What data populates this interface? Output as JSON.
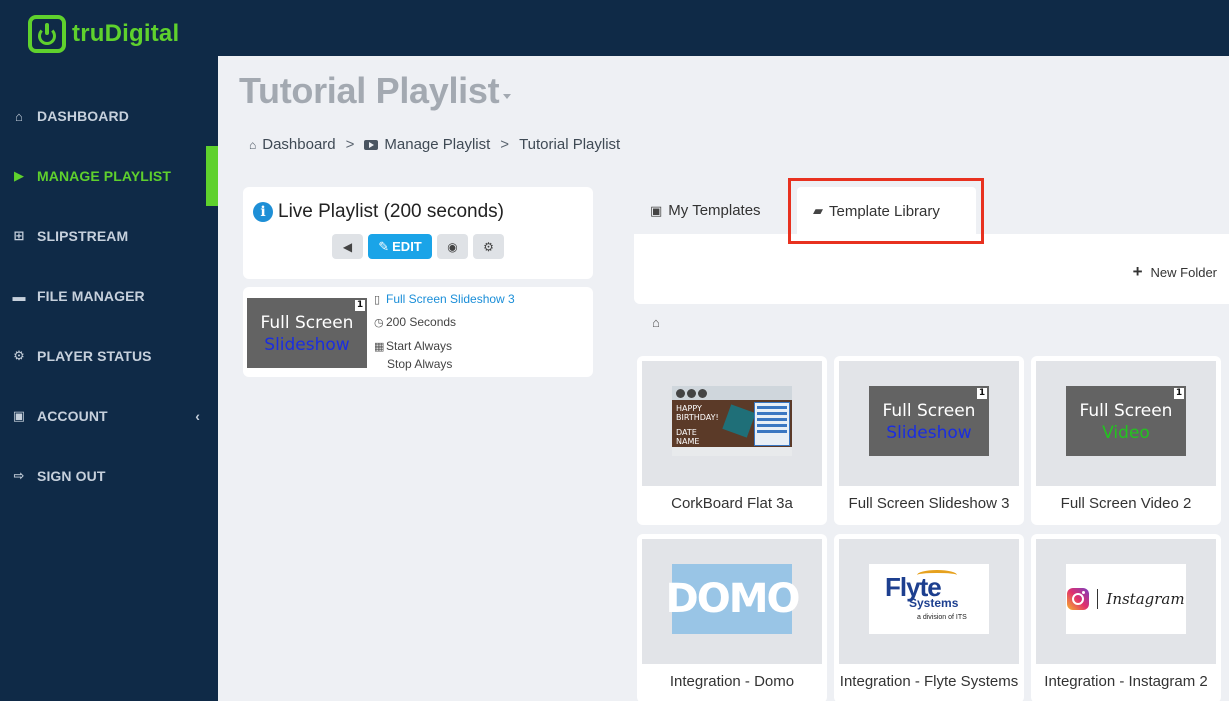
{
  "app": {
    "logo_text": "truDigital"
  },
  "sidebar": {
    "items": [
      {
        "label": "DASHBOARD",
        "icon": "home-icon"
      },
      {
        "label": "MANAGE PLAYLIST",
        "icon": "play-icon",
        "active": true
      },
      {
        "label": "SLIPSTREAM",
        "icon": "sitemap-icon"
      },
      {
        "label": "FILE MANAGER",
        "icon": "folder-icon"
      },
      {
        "label": "PLAYER STATUS",
        "icon": "gears-icon"
      },
      {
        "label": "ACCOUNT",
        "icon": "briefcase-icon",
        "chevron": "‹"
      },
      {
        "label": "SIGN OUT",
        "icon": "sign-out-icon"
      }
    ]
  },
  "page": {
    "title": "Tutorial Playlist"
  },
  "breadcrumb": {
    "home": "Dashboard",
    "manage": "Manage Playlist",
    "current": "Tutorial Playlist",
    "sep": ">"
  },
  "live_playlist": {
    "title": "Live Playlist (200 seconds)",
    "edit_label": "EDIT",
    "item": {
      "thumb_line1": "Full Screen",
      "thumb_line2": "Slideshow",
      "thumb_badge": "1",
      "name": "Full Screen Slideshow 3",
      "duration": "200 Seconds",
      "start": "Start Always",
      "stop": "Stop Always"
    }
  },
  "templates": {
    "tab_my": "My Templates",
    "tab_library": "Template Library",
    "new_folder": "New Folder",
    "items": [
      {
        "name": "CorkBoard Flat 3a",
        "bday_1": "HAPPY",
        "bday_2": "BIRTHDAY!",
        "bday_3": "DATE",
        "bday_4": "NAME"
      },
      {
        "name": "Full Screen Slideshow 3",
        "line1": "Full Screen",
        "line2": "Slideshow",
        "badge": "1",
        "accent": "#1a2ee0"
      },
      {
        "name": "Full Screen Video 2",
        "line1": "Full Screen",
        "line2": "Video",
        "badge": "1",
        "accent": "#22c41f"
      },
      {
        "name": "Integration - Domo",
        "logo": "DOMO"
      },
      {
        "name": "Integration - Flyte Systems",
        "logo1": "Flyte",
        "logo2": "Systems",
        "logo3": "a division of ITS"
      },
      {
        "name": "Integration - Instagram 2",
        "logo": "Instagram"
      }
    ]
  },
  "colors": {
    "accent_green": "#5fd12d",
    "sidebar_bg": "#0f2a47",
    "edit_blue": "#1aa4e8",
    "highlight_red": "#e8311f"
  }
}
